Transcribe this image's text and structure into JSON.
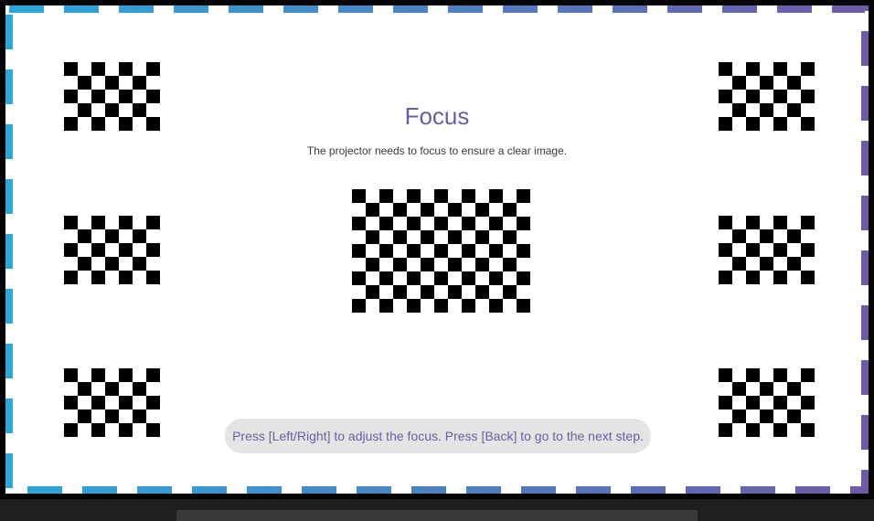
{
  "screen": {
    "title": "Focus",
    "subtitle": "The projector needs to focus to ensure a clear image.",
    "hint": "Press [Left/Right] to adjust the focus. Press [Back] to go to the next step."
  },
  "colors": {
    "title": "#6b5ba8",
    "hint_text": "#6b5ba8",
    "hint_background": "#e4e4e4",
    "border_gradient_start": "#2aa8dc",
    "border_gradient_end": "#6e5aa8",
    "checker_dark": "#000000",
    "checker_light": "#ffffff"
  },
  "icons": {
    "test_pattern": "checkerboard-pattern-icon"
  }
}
